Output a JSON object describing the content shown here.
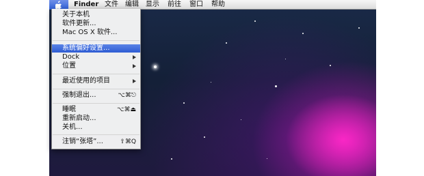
{
  "menubar": {
    "apple_icon": "apple-logo-icon",
    "app_name": "Finder",
    "items": [
      "文件",
      "编辑",
      "显示",
      "前往",
      "窗口",
      "帮助"
    ]
  },
  "apple_menu": {
    "items": [
      {
        "label": "关于本机"
      },
      {
        "label": "软件更新..."
      },
      {
        "label": "Mac OS X 软件..."
      },
      {
        "label": "系统偏好设置...",
        "highlighted": true
      },
      {
        "label": "Dock",
        "submenu": true
      },
      {
        "label": "位置",
        "submenu": true
      },
      {
        "label": "最近使用的项目",
        "submenu": true
      },
      {
        "label": "强制退出...",
        "shortcut": "⌥⌘⎋"
      },
      {
        "label": "睡眠",
        "shortcut": "⌥⌘⏏"
      },
      {
        "label": "重新启动..."
      },
      {
        "label": "关机..."
      },
      {
        "label": "注销“张塔”...",
        "shortcut": "⇧⌘Q"
      }
    ]
  },
  "colors": {
    "highlight": "#2d5bd3",
    "wallpaper_magenta": "#e020b8",
    "wallpaper_space": "#16213a"
  }
}
